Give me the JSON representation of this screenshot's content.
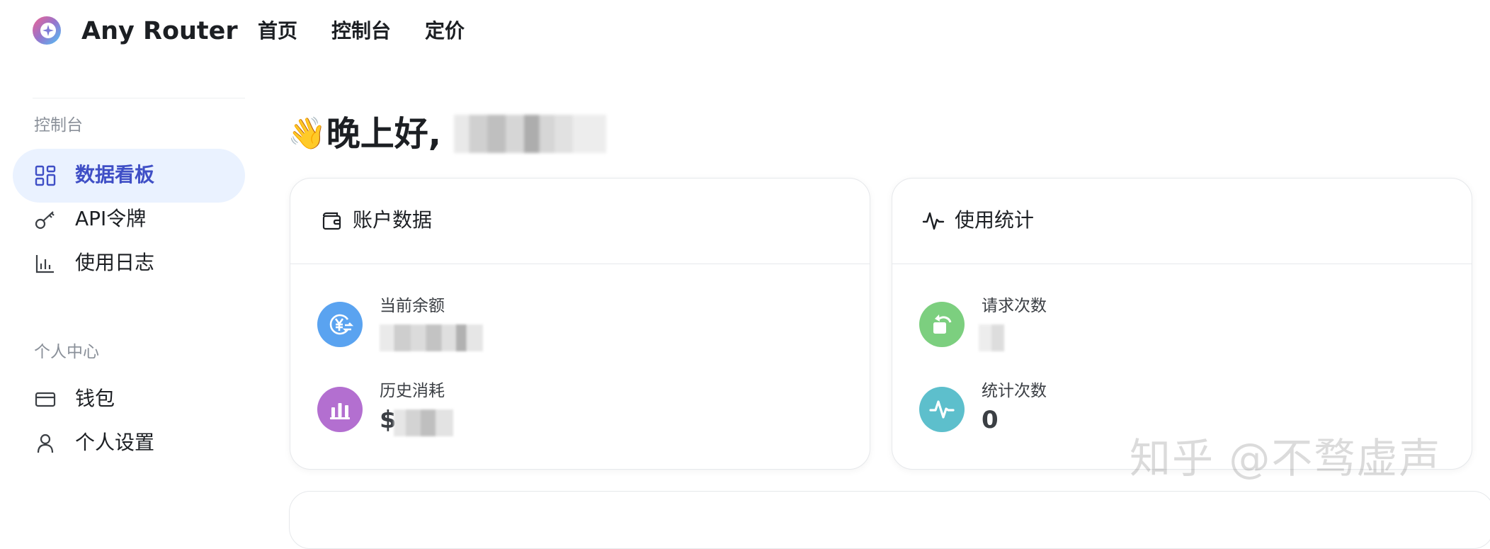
{
  "header": {
    "brand": "Any Router",
    "nav": [
      "首页",
      "控制台",
      "定价"
    ]
  },
  "sidebar": {
    "section_console": "控制台",
    "console_items": [
      {
        "label": "数据看板",
        "icon": "dashboard-icon",
        "active": true
      },
      {
        "label": "API令牌",
        "icon": "key-icon",
        "active": false
      },
      {
        "label": "使用日志",
        "icon": "bar-chart-icon",
        "active": false
      }
    ],
    "section_personal": "个人中心",
    "personal_items": [
      {
        "label": "钱包",
        "icon": "card-icon",
        "active": false
      },
      {
        "label": "个人设置",
        "icon": "user-icon",
        "active": false
      }
    ]
  },
  "greeting": {
    "emoji": "👋",
    "text": "晚上好,"
  },
  "account_card": {
    "title": "账户数据",
    "icon": "wallet-icon",
    "stats": [
      {
        "label": "当前余额",
        "icon": "yen-exchange-icon",
        "color": "#5aa3f0"
      },
      {
        "label": "历史消耗",
        "value_prefix": "$",
        "icon": "bar-chart-icon",
        "color": "#b36fd0"
      }
    ]
  },
  "usage_card": {
    "title": "使用统计",
    "icon": "activity-icon",
    "stats": [
      {
        "label": "请求次数",
        "icon": "rotate-icon",
        "color": "#7ccf7f"
      },
      {
        "label": "统计次数",
        "value": "0",
        "icon": "pulse-icon",
        "color": "#5dbfcc"
      }
    ]
  },
  "watermark": "知乎 @不骛虚声",
  "colors": {
    "accent": "#3f4fc6",
    "active_bg": "#eaf2ff"
  }
}
